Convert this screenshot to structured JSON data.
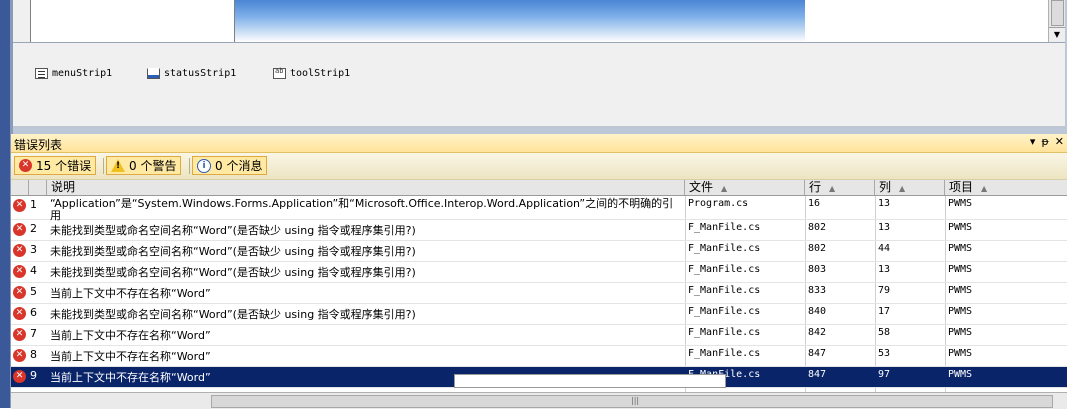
{
  "component_tray": {
    "items": [
      {
        "label": "menuStrip1",
        "icon": "menu-strip-icon"
      },
      {
        "label": "statusStrip1",
        "icon": "status-strip-icon"
      },
      {
        "label": "toolStrip1",
        "icon": "tool-strip-icon"
      }
    ]
  },
  "error_list": {
    "title": "错误列表",
    "controls": {
      "dropdown": "▾",
      "pin": "ᵽ",
      "close": "✕"
    },
    "filters": {
      "errors": "15 个错误",
      "warnings": "0 个警告",
      "messages": "0 个消息"
    },
    "columns": {
      "description": "说明",
      "file": "文件",
      "line": "行",
      "column": "列",
      "project": "项目"
    },
    "rows": [
      {
        "n": "1",
        "desc": "“Application”是“System.Windows.Forms.Application”和“Microsoft.Office.Interop.Word.Application”之间的不明确的引用",
        "file": "Program.cs",
        "line": "16",
        "col": "13",
        "project": "PWMS"
      },
      {
        "n": "2",
        "desc": "未能找到类型或命名空间名称“Word”(是否缺少 using 指令或程序集引用?)",
        "file": "F_ManFile.cs",
        "line": "802",
        "col": "13",
        "project": "PWMS"
      },
      {
        "n": "3",
        "desc": "未能找到类型或命名空间名称“Word”(是否缺少 using 指令或程序集引用?)",
        "file": "F_ManFile.cs",
        "line": "802",
        "col": "44",
        "project": "PWMS"
      },
      {
        "n": "4",
        "desc": "未能找到类型或命名空间名称“Word”(是否缺少 using 指令或程序集引用?)",
        "file": "F_ManFile.cs",
        "line": "803",
        "col": "13",
        "project": "PWMS"
      },
      {
        "n": "5",
        "desc": "当前上下文中不存在名称“Word”",
        "file": "F_ManFile.cs",
        "line": "833",
        "col": "79",
        "project": "PWMS"
      },
      {
        "n": "6",
        "desc": "未能找到类型或命名空间名称“Word”(是否缺少 using 指令或程序集引用?)",
        "file": "F_ManFile.cs",
        "line": "840",
        "col": "17",
        "project": "PWMS"
      },
      {
        "n": "7",
        "desc": "当前上下文中不存在名称“Word”",
        "file": "F_ManFile.cs",
        "line": "842",
        "col": "58",
        "project": "PWMS"
      },
      {
        "n": "8",
        "desc": "当前上下文中不存在名称“Word”",
        "file": "F_ManFile.cs",
        "line": "847",
        "col": "53",
        "project": "PWMS"
      },
      {
        "n": "9",
        "desc": "当前上下文中不存在名称“Word”",
        "file": "F_ManFile.cs",
        "line": "847",
        "col": "97",
        "project": "PWMS"
      }
    ]
  },
  "colors": {
    "title_bar": "#ffe39a",
    "selection": "#0a246a",
    "error_icon": "#d9352b"
  }
}
